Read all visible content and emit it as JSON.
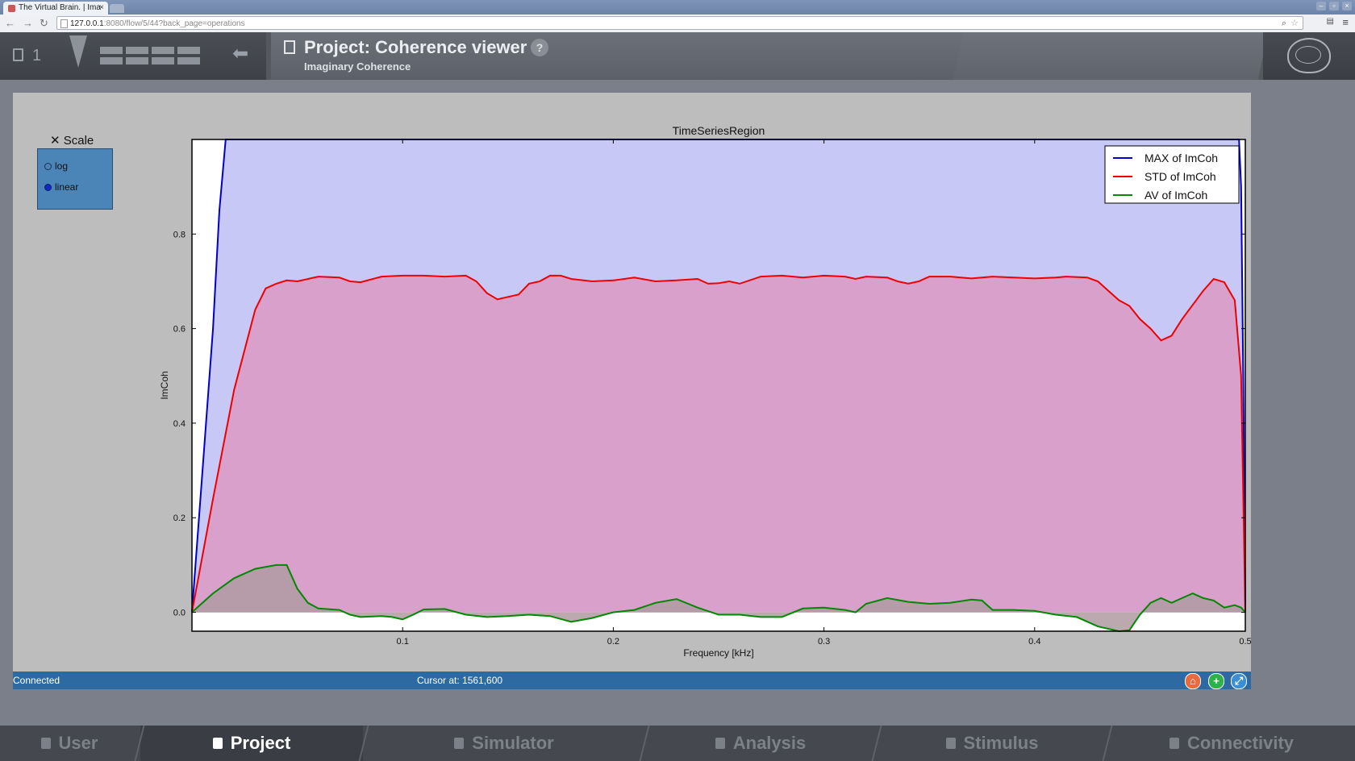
{
  "browser": {
    "tab_title": "The Virtual Brain. | Ima",
    "url_host": "127.0.0.1",
    "url_rest": ":8080/flow/5/44?back_page=operations"
  },
  "header": {
    "project_count": "1",
    "title": "Project: Coherence viewer",
    "subtitle": "Imaginary Coherence",
    "help": "?"
  },
  "xscale": {
    "title": "Scale",
    "options": [
      "log",
      "linear"
    ],
    "selected": "linear"
  },
  "status": {
    "connection": "Connected",
    "cursor": "Cursor at: 1561,600"
  },
  "nav": {
    "tabs": [
      "User",
      "Project",
      "Simulator",
      "Analysis",
      "Stimulus",
      "Connectivity"
    ],
    "active": "Project"
  },
  "chart_data": {
    "type": "area",
    "title": "TimeSeriesRegion",
    "xlabel": "Frequency [kHz]",
    "ylabel": "ImCoh",
    "xlim": [
      0.0,
      0.5
    ],
    "ylim": [
      -0.04,
      1.0
    ],
    "xticks": [
      "0.1",
      "0.2",
      "0.3",
      "0.4",
      "0.5"
    ],
    "yticks": [
      "0.0",
      "0.2",
      "0.4",
      "0.6",
      "0.8"
    ],
    "legend_position": "top-right",
    "series": [
      {
        "name": "MAX of ImCoh",
        "color": "#0000cc",
        "fill": "#c8c8f6",
        "points": [
          [
            0,
            0
          ],
          [
            0.005,
            0.3
          ],
          [
            0.01,
            0.6
          ],
          [
            0.013,
            0.85
          ],
          [
            0.016,
            1.0
          ],
          [
            0.1,
            1.0
          ],
          [
            0.2,
            1.0
          ],
          [
            0.3,
            1.0
          ],
          [
            0.4,
            1.0
          ],
          [
            0.497,
            1.0
          ],
          [
            0.498,
            0.9
          ],
          [
            0.499,
            0.5
          ],
          [
            0.5,
            0.02
          ]
        ]
      },
      {
        "name": "STD of ImCoh",
        "color": "#ee0000",
        "fill": "#d8a0cb",
        "points": [
          [
            0,
            0
          ],
          [
            0.01,
            0.24
          ],
          [
            0.02,
            0.47
          ],
          [
            0.03,
            0.64
          ],
          [
            0.035,
            0.685
          ],
          [
            0.04,
            0.695
          ],
          [
            0.045,
            0.702
          ],
          [
            0.05,
            0.7
          ],
          [
            0.06,
            0.71
          ],
          [
            0.07,
            0.708
          ],
          [
            0.075,
            0.7
          ],
          [
            0.08,
            0.698
          ],
          [
            0.09,
            0.71
          ],
          [
            0.1,
            0.712
          ],
          [
            0.11,
            0.712
          ],
          [
            0.12,
            0.71
          ],
          [
            0.13,
            0.712
          ],
          [
            0.135,
            0.7
          ],
          [
            0.14,
            0.675
          ],
          [
            0.145,
            0.662
          ],
          [
            0.15,
            0.667
          ],
          [
            0.155,
            0.672
          ],
          [
            0.16,
            0.695
          ],
          [
            0.165,
            0.7
          ],
          [
            0.17,
            0.712
          ],
          [
            0.175,
            0.712
          ],
          [
            0.18,
            0.705
          ],
          [
            0.19,
            0.7
          ],
          [
            0.2,
            0.702
          ],
          [
            0.21,
            0.708
          ],
          [
            0.22,
            0.7
          ],
          [
            0.23,
            0.702
          ],
          [
            0.24,
            0.705
          ],
          [
            0.245,
            0.695
          ],
          [
            0.25,
            0.696
          ],
          [
            0.255,
            0.7
          ],
          [
            0.26,
            0.695
          ],
          [
            0.27,
            0.71
          ],
          [
            0.28,
            0.712
          ],
          [
            0.29,
            0.708
          ],
          [
            0.3,
            0.712
          ],
          [
            0.31,
            0.71
          ],
          [
            0.315,
            0.705
          ],
          [
            0.32,
            0.71
          ],
          [
            0.33,
            0.708
          ],
          [
            0.335,
            0.7
          ],
          [
            0.34,
            0.695
          ],
          [
            0.345,
            0.7
          ],
          [
            0.35,
            0.71
          ],
          [
            0.36,
            0.71
          ],
          [
            0.37,
            0.706
          ],
          [
            0.38,
            0.71
          ],
          [
            0.39,
            0.708
          ],
          [
            0.4,
            0.706
          ],
          [
            0.41,
            0.708
          ],
          [
            0.415,
            0.71
          ],
          [
            0.425,
            0.708
          ],
          [
            0.43,
            0.7
          ],
          [
            0.435,
            0.68
          ],
          [
            0.44,
            0.66
          ],
          [
            0.445,
            0.648
          ],
          [
            0.45,
            0.62
          ],
          [
            0.455,
            0.6
          ],
          [
            0.46,
            0.575
          ],
          [
            0.465,
            0.585
          ],
          [
            0.47,
            0.62
          ],
          [
            0.475,
            0.65
          ],
          [
            0.48,
            0.68
          ],
          [
            0.485,
            0.705
          ],
          [
            0.49,
            0.698
          ],
          [
            0.495,
            0.66
          ],
          [
            0.498,
            0.5
          ],
          [
            0.5,
            0.0
          ]
        ]
      },
      {
        "name": "AV of ImCoh",
        "color": "#008800",
        "fill": "#b09aa2",
        "points": [
          [
            0,
            0
          ],
          [
            0.01,
            0.04
          ],
          [
            0.02,
            0.072
          ],
          [
            0.03,
            0.092
          ],
          [
            0.04,
            0.1
          ],
          [
            0.045,
            0.1
          ],
          [
            0.05,
            0.05
          ],
          [
            0.055,
            0.02
          ],
          [
            0.06,
            0.008
          ],
          [
            0.07,
            0.005
          ],
          [
            0.075,
            -0.005
          ],
          [
            0.08,
            -0.01
          ],
          [
            0.09,
            -0.008
          ],
          [
            0.095,
            -0.01
          ],
          [
            0.1,
            -0.015
          ],
          [
            0.105,
            -0.005
          ],
          [
            0.11,
            0.006
          ],
          [
            0.12,
            0.007
          ],
          [
            0.13,
            -0.005
          ],
          [
            0.14,
            -0.01
          ],
          [
            0.15,
            -0.008
          ],
          [
            0.16,
            -0.005
          ],
          [
            0.17,
            -0.008
          ],
          [
            0.18,
            -0.02
          ],
          [
            0.19,
            -0.012
          ],
          [
            0.2,
            0.0
          ],
          [
            0.21,
            0.005
          ],
          [
            0.22,
            0.02
          ],
          [
            0.23,
            0.028
          ],
          [
            0.24,
            0.01
          ],
          [
            0.25,
            -0.005
          ],
          [
            0.26,
            -0.005
          ],
          [
            0.27,
            -0.01
          ],
          [
            0.28,
            -0.01
          ],
          [
            0.29,
            0.008
          ],
          [
            0.3,
            0.01
          ],
          [
            0.31,
            0.005
          ],
          [
            0.315,
            0.0
          ],
          [
            0.32,
            0.018
          ],
          [
            0.33,
            0.03
          ],
          [
            0.34,
            0.022
          ],
          [
            0.35,
            0.018
          ],
          [
            0.36,
            0.02
          ],
          [
            0.37,
            0.027
          ],
          [
            0.375,
            0.025
          ],
          [
            0.38,
            0.005
          ],
          [
            0.39,
            0.005
          ],
          [
            0.4,
            0.003
          ],
          [
            0.41,
            -0.005
          ],
          [
            0.42,
            -0.01
          ],
          [
            0.43,
            -0.03
          ],
          [
            0.44,
            -0.04
          ],
          [
            0.445,
            -0.038
          ],
          [
            0.45,
            -0.005
          ],
          [
            0.455,
            0.02
          ],
          [
            0.46,
            0.03
          ],
          [
            0.465,
            0.02
          ],
          [
            0.47,
            0.03
          ],
          [
            0.475,
            0.04
          ],
          [
            0.48,
            0.03
          ],
          [
            0.485,
            0.025
          ],
          [
            0.49,
            0.01
          ],
          [
            0.495,
            0.015
          ],
          [
            0.498,
            0.01
          ],
          [
            0.5,
            0.0
          ]
        ]
      }
    ]
  }
}
